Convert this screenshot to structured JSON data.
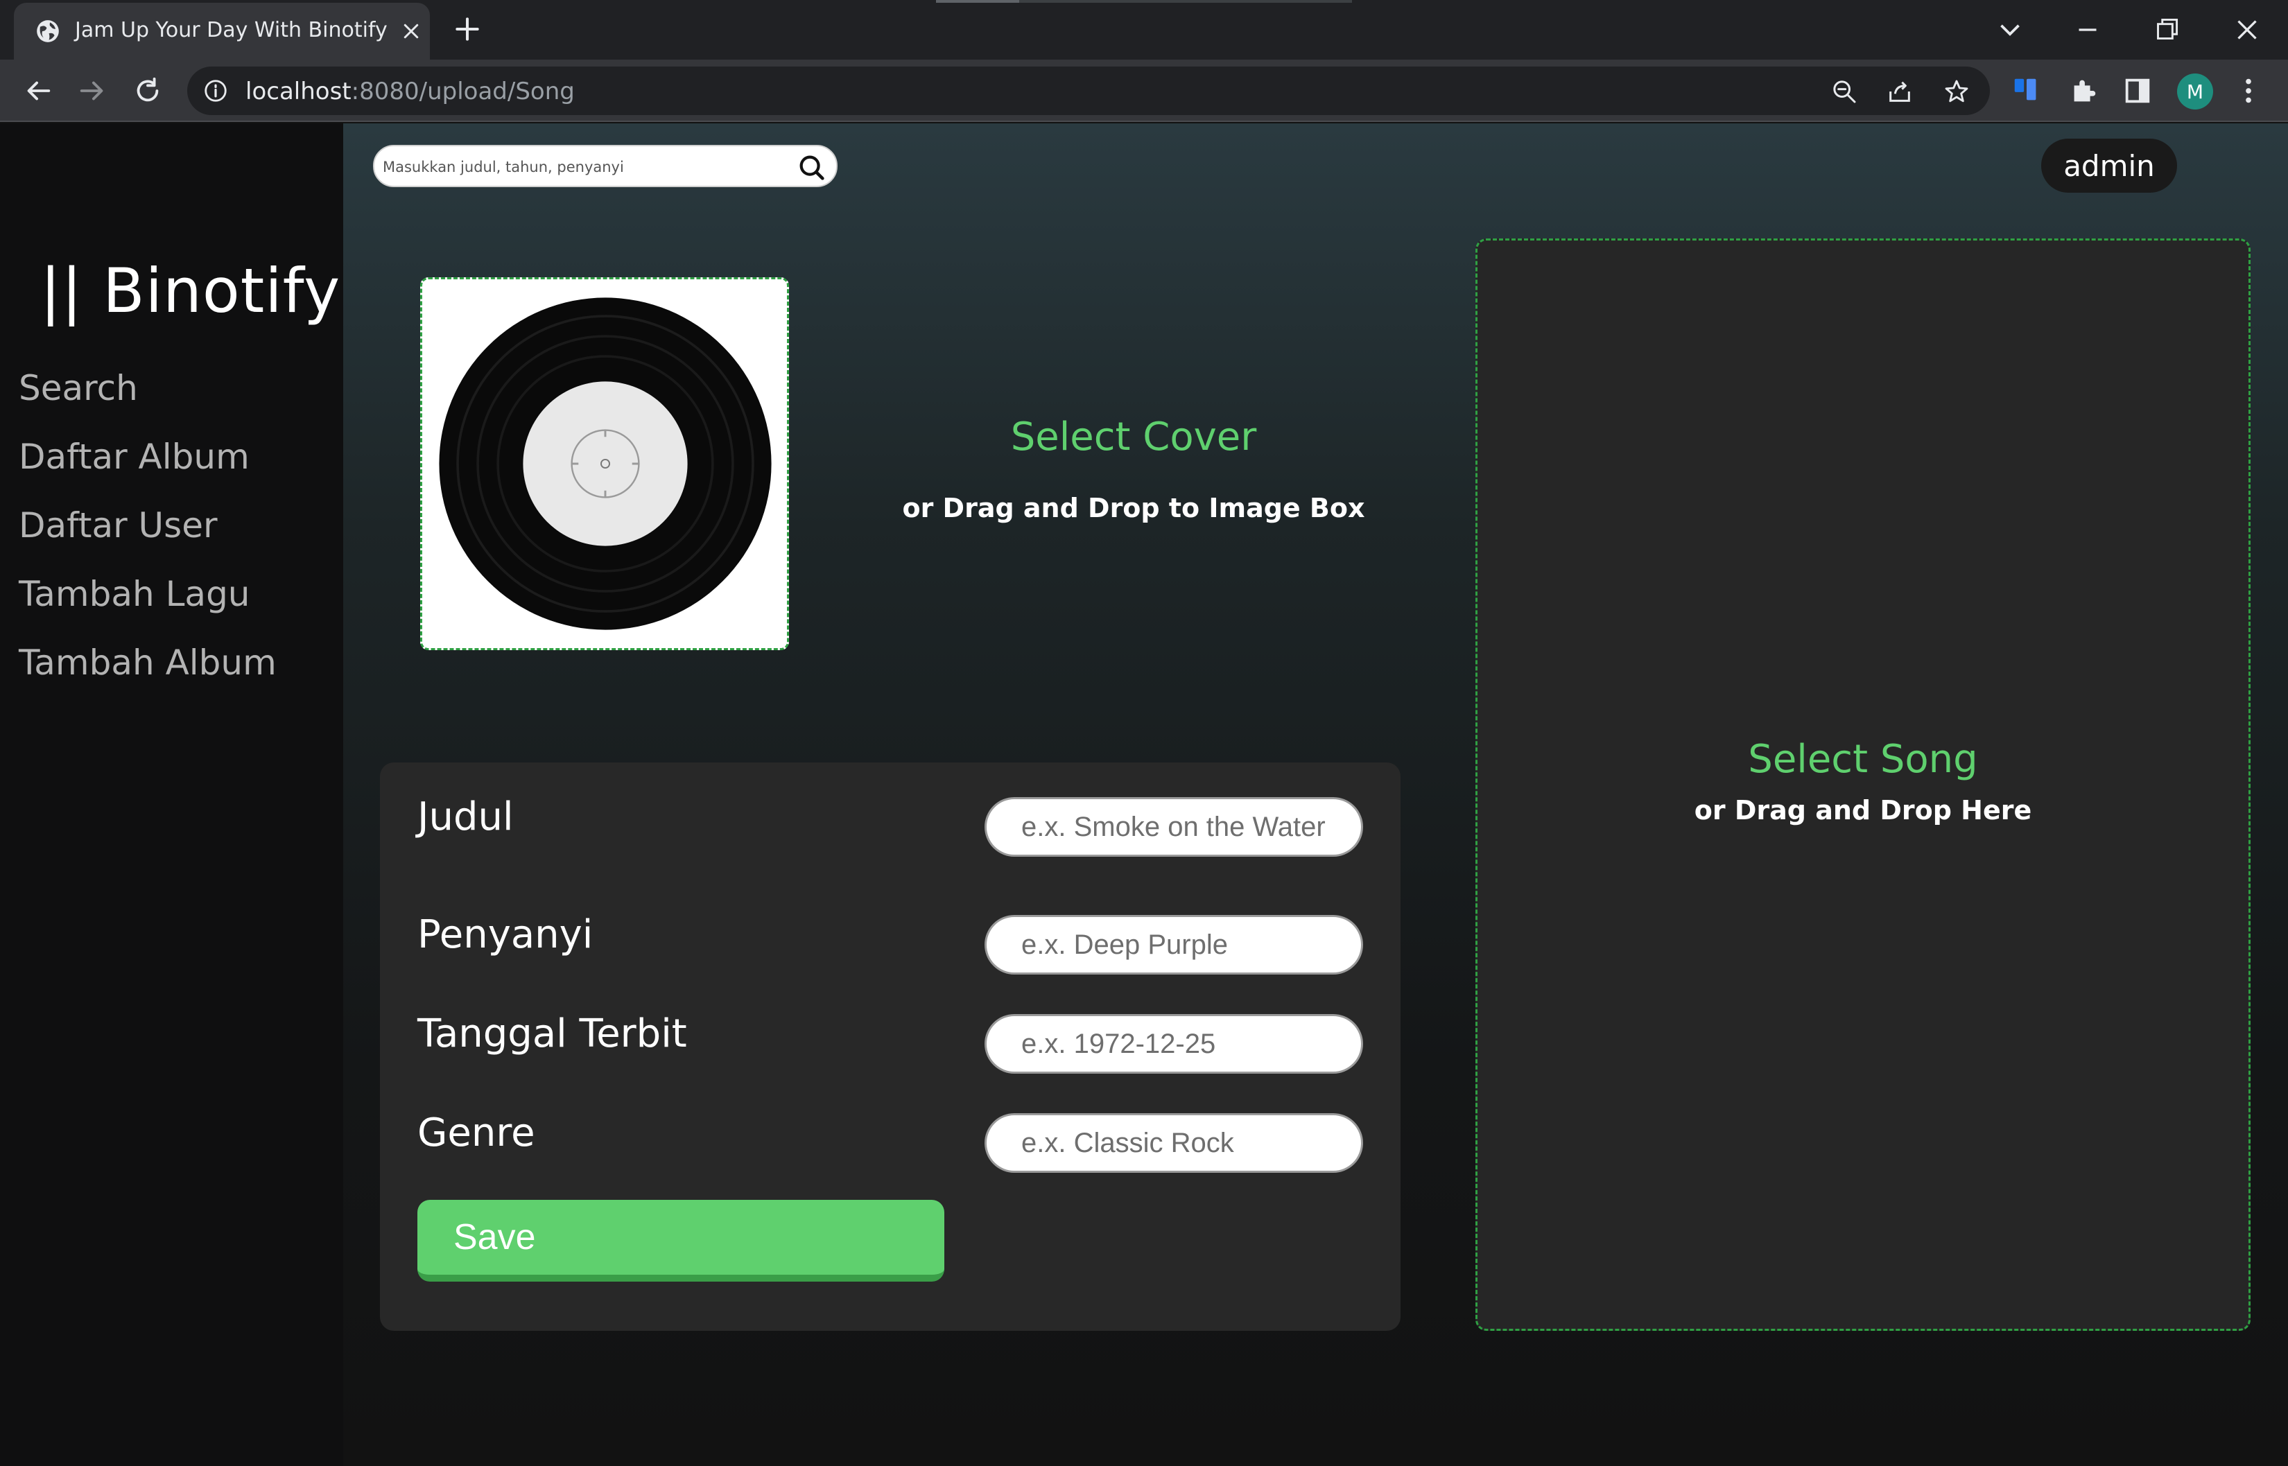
{
  "browser": {
    "tab_title": "Jam Up Your Day With Binotify",
    "url_host": "localhost",
    "url_rest": ":8080/upload/Song",
    "profile_initial": "M"
  },
  "sidebar": {
    "logo": "|| Binotify",
    "items": [
      {
        "label": "Search"
      },
      {
        "label": "Daftar Album"
      },
      {
        "label": "Daftar User"
      },
      {
        "label": "Tambah Lagu"
      },
      {
        "label": "Tambah Album"
      }
    ]
  },
  "header": {
    "search_placeholder": "Masukkan judul, tahun, penyanyi",
    "user": "admin"
  },
  "cover": {
    "title": "Select Cover",
    "subtitle": "or Drag and Drop to Image Box"
  },
  "form": {
    "fields": [
      {
        "label": "Judul",
        "placeholder": "e.x. Smoke on the Water"
      },
      {
        "label": "Penyanyi",
        "placeholder": "e.x. Deep Purple"
      },
      {
        "label": "Tanggal Terbit",
        "placeholder": "e.x. 1972-12-25"
      },
      {
        "label": "Genre",
        "placeholder": "e.x. Classic Rock"
      }
    ],
    "save_label": "Save"
  },
  "song": {
    "title": "Select Song",
    "subtitle": "or Drag and Drop Here"
  },
  "colors": {
    "accent": "#5fd06e",
    "dashed_border": "#2fa043",
    "sidebar_bg": "#0f0f10",
    "panel_bg": "#282828"
  }
}
